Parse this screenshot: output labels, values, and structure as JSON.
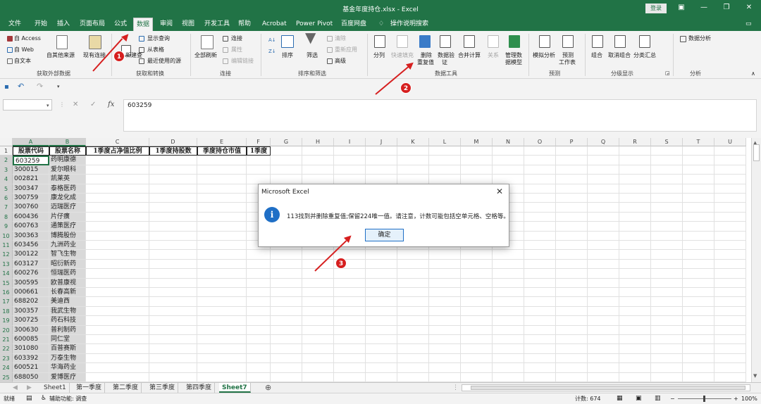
{
  "window": {
    "title": "基金年度持仓.xlsx - Excel",
    "login_label": "登录"
  },
  "menu": {
    "tabs": [
      "文件",
      "开始",
      "插入",
      "页面布局",
      "公式",
      "数据",
      "审阅",
      "视图",
      "开发工具",
      "帮助",
      "Acrobat",
      "Power Pivot",
      "百度网盘",
      "操作说明搜索"
    ],
    "active_tab": "数据"
  },
  "ribbon": {
    "groups": {
      "external": {
        "title": "获取外部数据",
        "access": "自 Access",
        "web": "自 Web",
        "text": "自文本",
        "other": "自其他来源",
        "existing": "现有连接"
      },
      "transform": {
        "title": "获取和转换",
        "new_query_part": "新建查",
        "show_query": "显示查询",
        "from_table": "从表格",
        "recent": "最近使用的源"
      },
      "connections": {
        "title": "连接",
        "refresh_all": "全部刷新",
        "connections": "连接",
        "properties": "属性",
        "edit_links": "编辑链接"
      },
      "sort_filter": {
        "title": "排序和筛选",
        "sort": "排序",
        "filter": "筛选",
        "clear": "清除",
        "reapply": "重新应用",
        "advanced": "高级"
      },
      "data_tools": {
        "title": "数据工具",
        "split": "分列",
        "flash_fill": "快速填充",
        "remove_dup_1": "删除",
        "remove_dup_2": "重复值",
        "validation_1": "数据验",
        "validation_2": "证",
        "consolidate": "合并计算",
        "relations": "关系",
        "model_1": "管理数",
        "model_2": "据模型"
      },
      "forecast": {
        "title": "预测",
        "what_if": "模拟分析",
        "sheet_1": "预测",
        "sheet_2": "工作表"
      },
      "outline": {
        "title": "分级显示",
        "group": "组合",
        "ungroup": "取消组合",
        "subtotal": "分类汇总"
      },
      "analysis": {
        "title": "分析",
        "data_analysis": "数据分析"
      }
    }
  },
  "formula_bar": {
    "name_box": "",
    "value": "603259"
  },
  "grid": {
    "columns": [
      "A",
      "B",
      "C",
      "D",
      "E",
      "F",
      "G",
      "H",
      "I",
      "J",
      "K",
      "L",
      "M",
      "N",
      "O",
      "P",
      "Q",
      "R",
      "S",
      "T",
      "U"
    ],
    "selected_columns": [
      "A",
      "B"
    ],
    "header_row": [
      "股票代码",
      "股票名称",
      "1季度占净值比例",
      "1季度持股数",
      "季度持仓市值",
      "1季度"
    ],
    "rows": [
      [
        "603259",
        "药明康德"
      ],
      [
        "300015",
        "爱尔眼科"
      ],
      [
        "002821",
        "凯莱英"
      ],
      [
        "300347",
        "泰格医药"
      ],
      [
        "300759",
        "康龙化成"
      ],
      [
        "300760",
        "迈瑞医疗"
      ],
      [
        "600436",
        "片仔癀"
      ],
      [
        "600763",
        "通策医疗"
      ],
      [
        "300363",
        "博腾股份"
      ],
      [
        "603456",
        "九洲药业"
      ],
      [
        "300122",
        "智飞生物"
      ],
      [
        "603127",
        "昭衍新药"
      ],
      [
        "600276",
        "恒瑞医药"
      ],
      [
        "300595",
        "欧普康视"
      ],
      [
        "000661",
        "长春高新"
      ],
      [
        "688202",
        "美迪西"
      ],
      [
        "300357",
        "我武生物"
      ],
      [
        "300725",
        "药石科技"
      ],
      [
        "300630",
        "普利制药"
      ],
      [
        "600085",
        "同仁堂"
      ],
      [
        "301080",
        "百普赛斯"
      ],
      [
        "603392",
        "万泰生物"
      ],
      [
        "600521",
        "华海药业"
      ],
      [
        "688050",
        "爱博医疗"
      ]
    ]
  },
  "dialog": {
    "title": "Microsoft Excel",
    "message": "113找到并删除重复值;保留224唯一值。请注意，计数可能包括空单元格、空格等。",
    "ok_label": "确定"
  },
  "sheet_tabs": {
    "tabs": [
      "Sheet1",
      "第一季度",
      "第二季度",
      "第三季度",
      "第四季度",
      "Sheet7"
    ],
    "active": "Sheet7"
  },
  "status": {
    "mode": "就绪",
    "accessibility": "辅助功能: 调查",
    "count": "计数: 674",
    "zoom": "100%"
  },
  "annotations": [
    "1",
    "2",
    "3"
  ],
  "colors": {
    "excel_green": "#217346",
    "annotation_red": "#d61f1f",
    "dialog_accent": "#1f6fc6"
  }
}
